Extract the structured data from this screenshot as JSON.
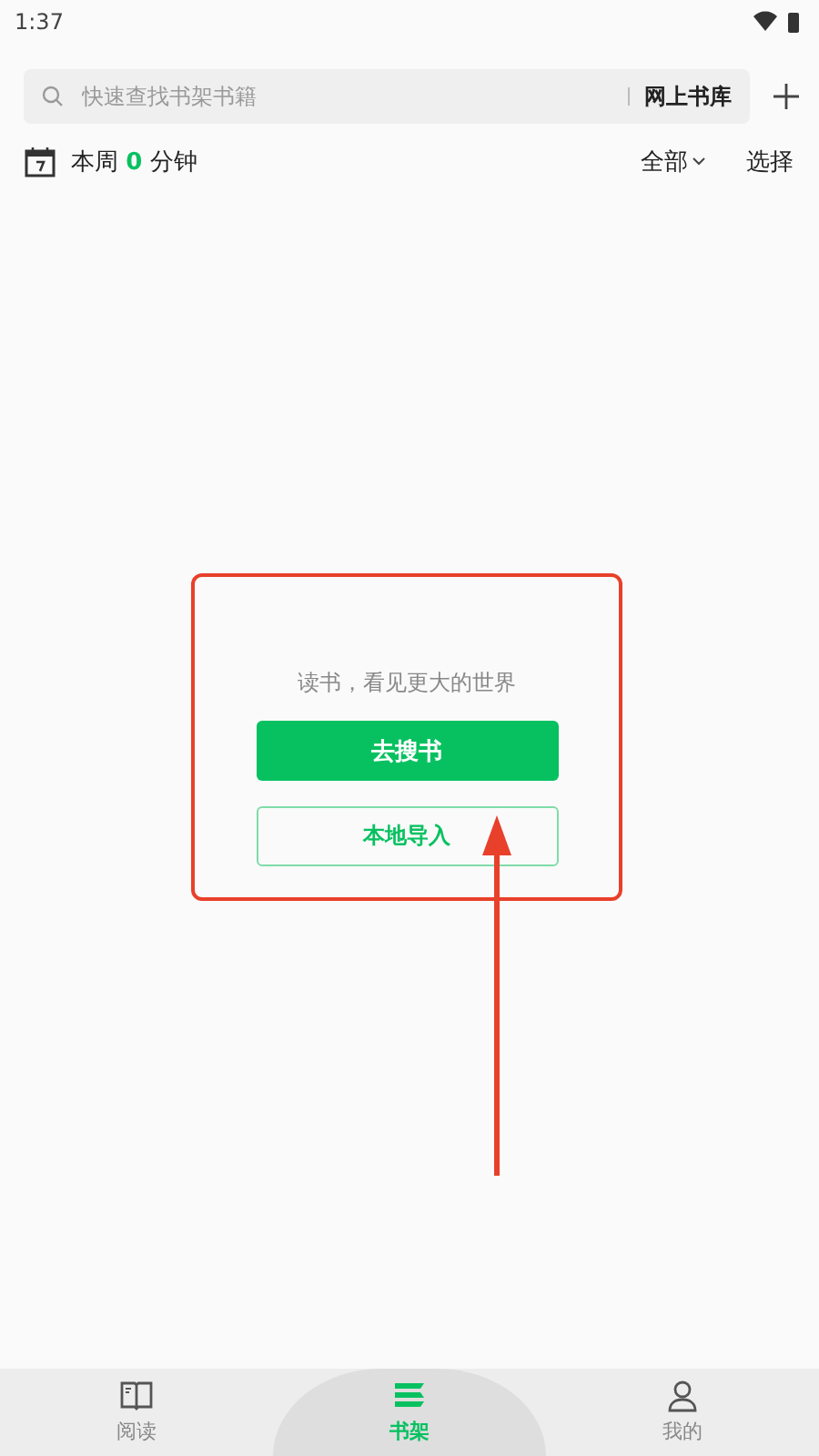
{
  "status_bar": {
    "time": "1:37"
  },
  "search": {
    "placeholder": "快速查找书架书籍",
    "store_link": "网上书库"
  },
  "week": {
    "label": "本周",
    "minutes": "0",
    "unit": "分钟",
    "filter": "全部",
    "select": "选择"
  },
  "empty_state": {
    "message": "读书，看见更大的世界",
    "primary_button": "去搜书",
    "secondary_button": "本地导入"
  },
  "tabs": [
    {
      "label": "阅读",
      "kind": "book",
      "selected": false
    },
    {
      "label": "书架",
      "kind": "shelf",
      "selected": true
    },
    {
      "label": "我的",
      "kind": "person",
      "selected": false
    }
  ]
}
